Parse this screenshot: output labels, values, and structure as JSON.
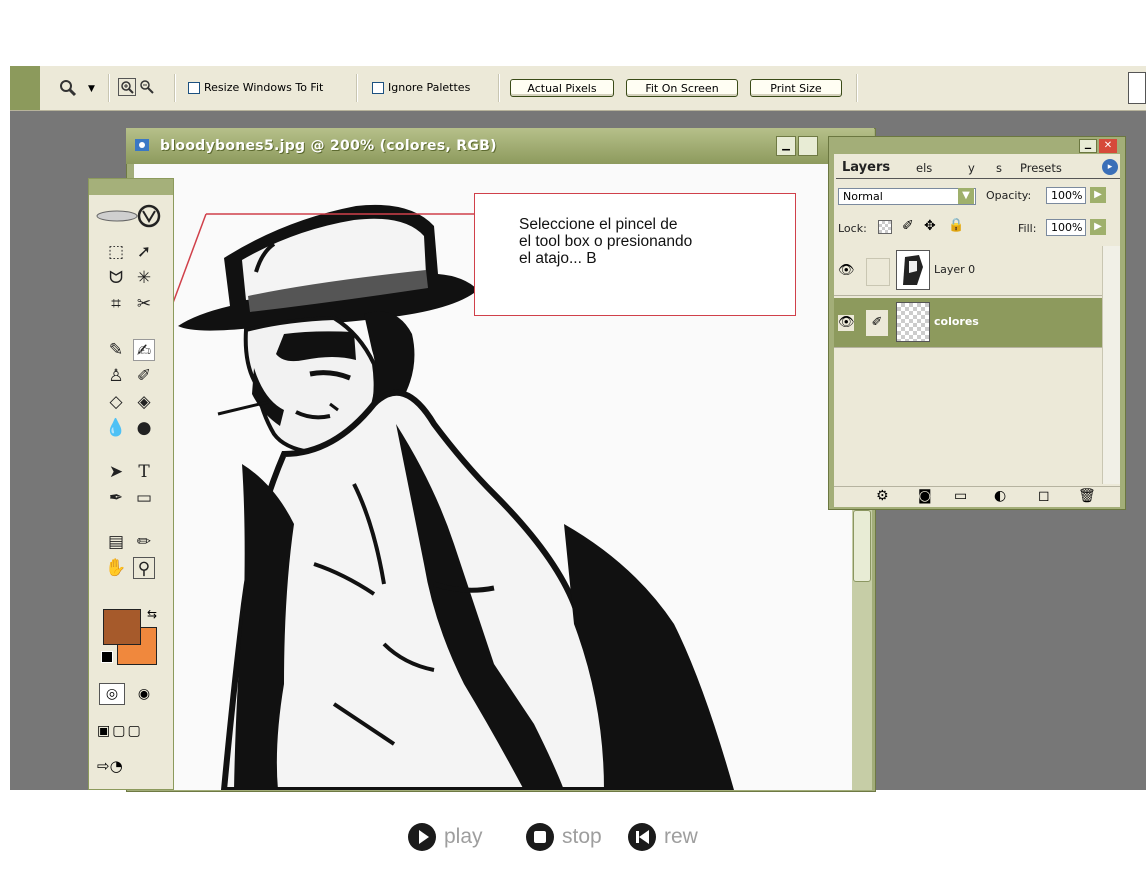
{
  "options_bar": {
    "resize_windows_label": "Resize Windows To Fit",
    "ignore_palettes_label": "Ignore Palettes",
    "actual_pixels_label": "Actual Pixels",
    "fit_on_screen_label": "Fit On Screen",
    "print_size_label": "Print Size",
    "zoom_tool_icon": "zoom-icon",
    "zoom_in_icon": "zoom-in-icon",
    "zoom_out_icon": "zoom-out-icon"
  },
  "document": {
    "title": "bloodybones5.jpg @ 200% (colores, RGB)"
  },
  "callout": {
    "line1": "Seleccione el pincel de",
    "line2": "el tool box o presionando",
    "line3": "el atajo... B"
  },
  "layers_palette": {
    "tabs": [
      "Layers",
      "els",
      "y",
      "s",
      "Presets"
    ],
    "blend_mode": "Normal",
    "opacity_label": "Opacity:",
    "opacity_value": "100%",
    "lock_label": "Lock:",
    "fill_label": "Fill:",
    "fill_value": "100%",
    "layers": [
      {
        "name": "Layer 0",
        "selected": false
      },
      {
        "name": "colores",
        "selected": true
      }
    ]
  },
  "colors": {
    "foreground": "#a65a2b",
    "background": "#f0883d",
    "accent": "#8c9a5c",
    "callout_border": "#d0404a"
  },
  "player": {
    "play_label": "play",
    "stop_label": "stop",
    "rew_label": "rew"
  }
}
